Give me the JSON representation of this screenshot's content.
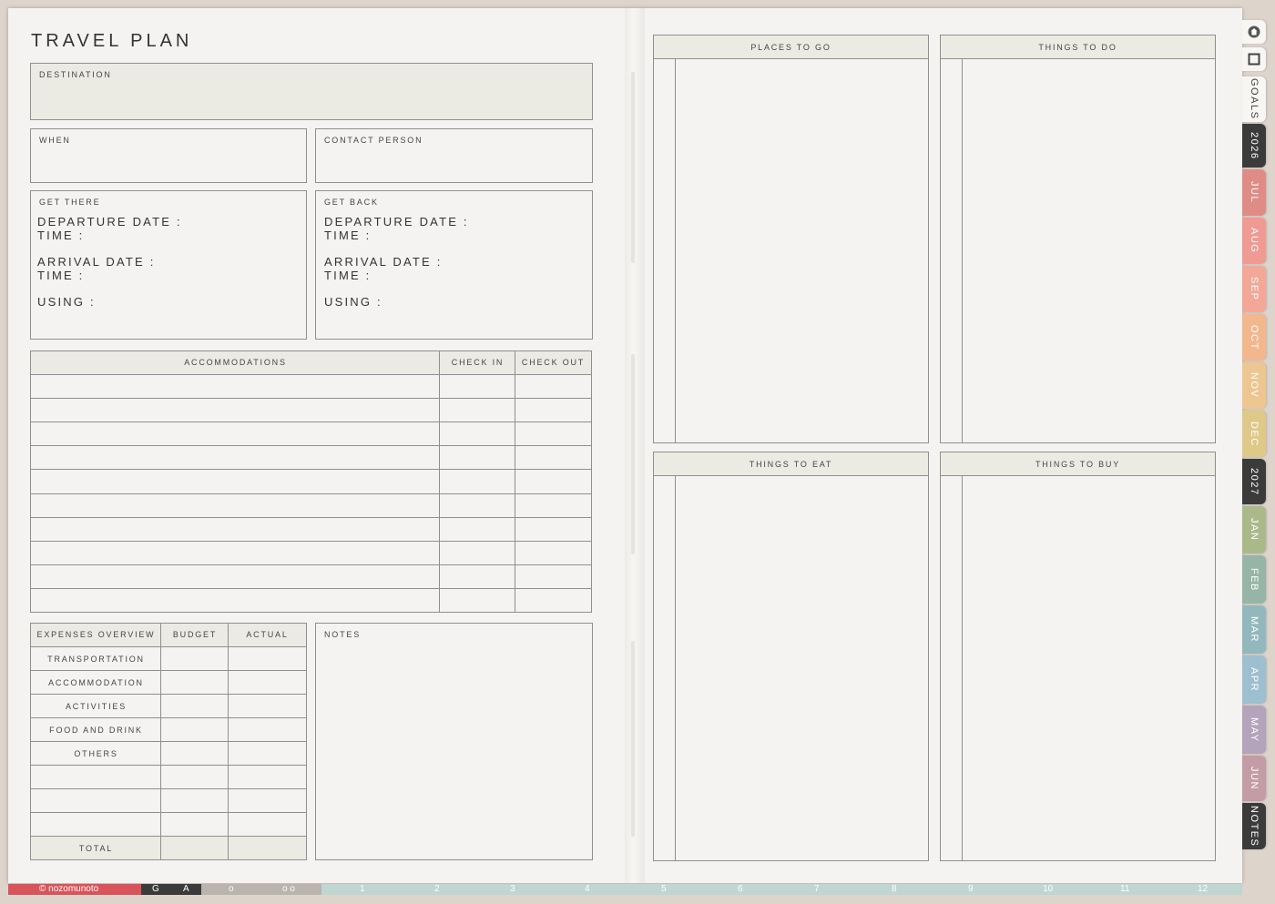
{
  "left_page": {
    "title": "TRAVEL PLAN",
    "destination_label": "DESTINATION",
    "when_label": "WHEN",
    "contact_label": "CONTACT PERSON",
    "get_there": {
      "label": "GET THERE",
      "departure_date": "DEPARTURE DATE :",
      "departure_time": "TIME :",
      "arrival_date": "ARRIVAL DATE :",
      "arrival_time": "TIME :",
      "using": "USING :"
    },
    "get_back": {
      "label": "GET BACK",
      "departure_date": "DEPARTURE DATE :",
      "departure_time": "TIME :",
      "arrival_date": "ARRIVAL DATE :",
      "arrival_time": "TIME :",
      "using": "USING :"
    },
    "accommodations": {
      "headers": [
        "ACCOMMODATIONS",
        "CHECK IN",
        "CHECK OUT"
      ],
      "empty_rows": 10
    },
    "expenses": {
      "headers": [
        "EXPENSES OVERVIEW",
        "BUDGET",
        "ACTUAL"
      ],
      "rows": [
        "TRANSPORTATION",
        "ACCOMMODATION",
        "ACTIVITIES",
        "FOOD AND DRINK",
        "OTHERS",
        "",
        "",
        ""
      ],
      "total_label": "TOTAL"
    },
    "notes_label": "NOTES"
  },
  "right_page": {
    "places_to_go": "PLACES TO GO",
    "things_to_do": "THINGS TO DO",
    "things_to_eat": "THINGS TO EAT",
    "things_to_buy": "THINGS TO BUY"
  },
  "side_tabs": [
    {
      "label": "home-icon",
      "kind": "icon",
      "color": "#f7f6f3"
    },
    {
      "label": "square-icon",
      "kind": "icon",
      "color": "#f7f6f3"
    },
    {
      "label": "GOALS",
      "kind": "text",
      "color": "#f7f6f3",
      "text_color": "#444444"
    },
    {
      "label": "2026",
      "kind": "text",
      "color": "#3b3b3b",
      "text_color": "#ffffff"
    },
    {
      "label": "JUL",
      "kind": "text",
      "color": "#e08c86",
      "text_color": "#ffffff"
    },
    {
      "label": "AUG",
      "kind": "text",
      "color": "#ef9a93",
      "text_color": "#ffffff"
    },
    {
      "label": "SEP",
      "kind": "text",
      "color": "#f2a797",
      "text_color": "#ffffff"
    },
    {
      "label": "OCT",
      "kind": "text",
      "color": "#f3b78e",
      "text_color": "#ffffff"
    },
    {
      "label": "NOV",
      "kind": "text",
      "color": "#edc691",
      "text_color": "#ffffff"
    },
    {
      "label": "DEC",
      "kind": "text",
      "color": "#dfc988",
      "text_color": "#ffffff"
    },
    {
      "label": "2027",
      "kind": "text",
      "color": "#3b3b3b",
      "text_color": "#ffffff"
    },
    {
      "label": "JAN",
      "kind": "text",
      "color": "#aab98a",
      "text_color": "#ffffff"
    },
    {
      "label": "FEB",
      "kind": "text",
      "color": "#97b5a6",
      "text_color": "#ffffff"
    },
    {
      "label": "MAR",
      "kind": "text",
      "color": "#92b8bd",
      "text_color": "#ffffff"
    },
    {
      "label": "APR",
      "kind": "text",
      "color": "#9dbfcf",
      "text_color": "#ffffff"
    },
    {
      "label": "MAY",
      "kind": "text",
      "color": "#b3a4bb",
      "text_color": "#ffffff"
    },
    {
      "label": "JUN",
      "kind": "text",
      "color": "#c39ca5",
      "text_color": "#ffffff"
    },
    {
      "label": "NOTES",
      "kind": "text",
      "color": "#3b3b3b",
      "text_color": "#ffffff"
    }
  ],
  "bottom_bar": {
    "brand": "© nozomunoto",
    "letters": [
      "G",
      "A"
    ],
    "dots": [
      "o",
      "o o"
    ],
    "months": [
      "1",
      "2",
      "3",
      "4",
      "5",
      "6",
      "7",
      "8",
      "9",
      "10",
      "11",
      "12"
    ],
    "colors": {
      "brand": "#d9545a",
      "dark": "#3b3b3b",
      "gray": "#b9b5ae",
      "teal": "#bfd6d3"
    }
  }
}
